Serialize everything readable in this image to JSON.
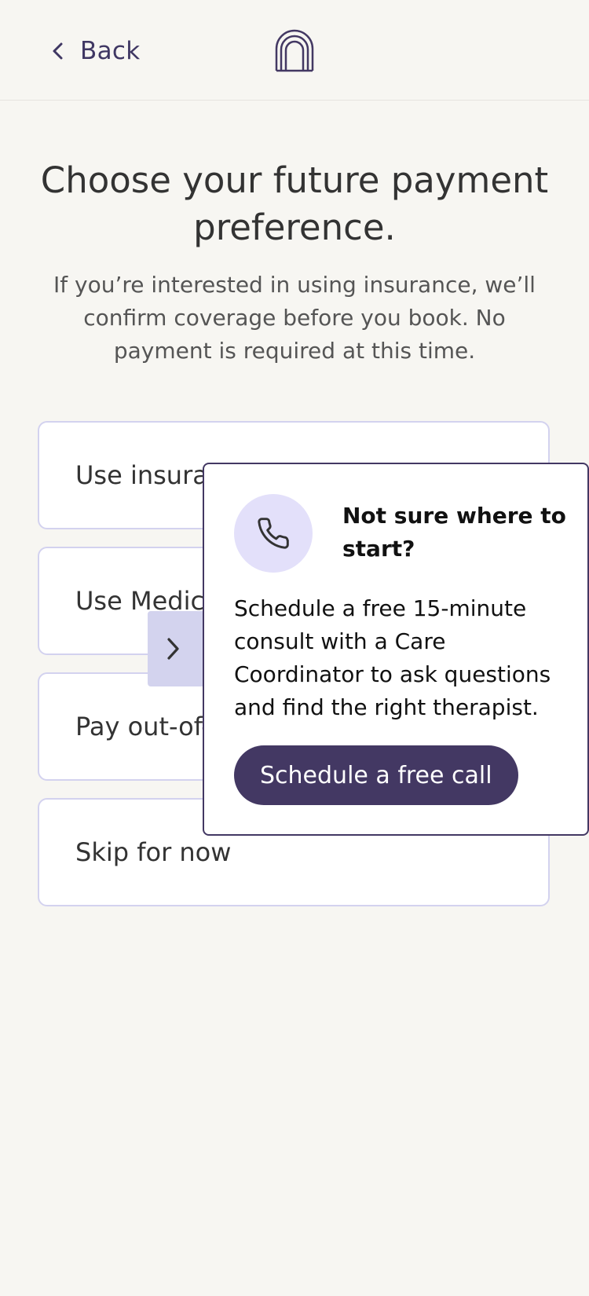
{
  "header": {
    "back_label": "Back"
  },
  "main": {
    "title": "Choose your future payment preference.",
    "subtitle": "If you’re interested in using insurance, we’ll confirm coverage before you book. No payment is required at this time."
  },
  "options": [
    {
      "label": "Use insurance"
    },
    {
      "label": "Use Medicaid"
    },
    {
      "label": "Pay out-of-pocket"
    },
    {
      "label": "Skip for now"
    }
  ],
  "tooltip": {
    "title": "Not sure where to start?",
    "body": "Schedule a free 15-minute consult with a Care Coordinator to ask questions and find the right therapist.",
    "cta_label": "Schedule a free call"
  },
  "colors": {
    "brand": "#433863",
    "option_border": "#d3d2ef",
    "icon_bg": "#e3e0fa",
    "page_bg": "#f7f6f2"
  },
  "icons": {
    "back": "chevron-left-icon",
    "logo": "arch-logo-icon",
    "phone": "phone-icon",
    "arrow": "chevron-right-icon"
  }
}
